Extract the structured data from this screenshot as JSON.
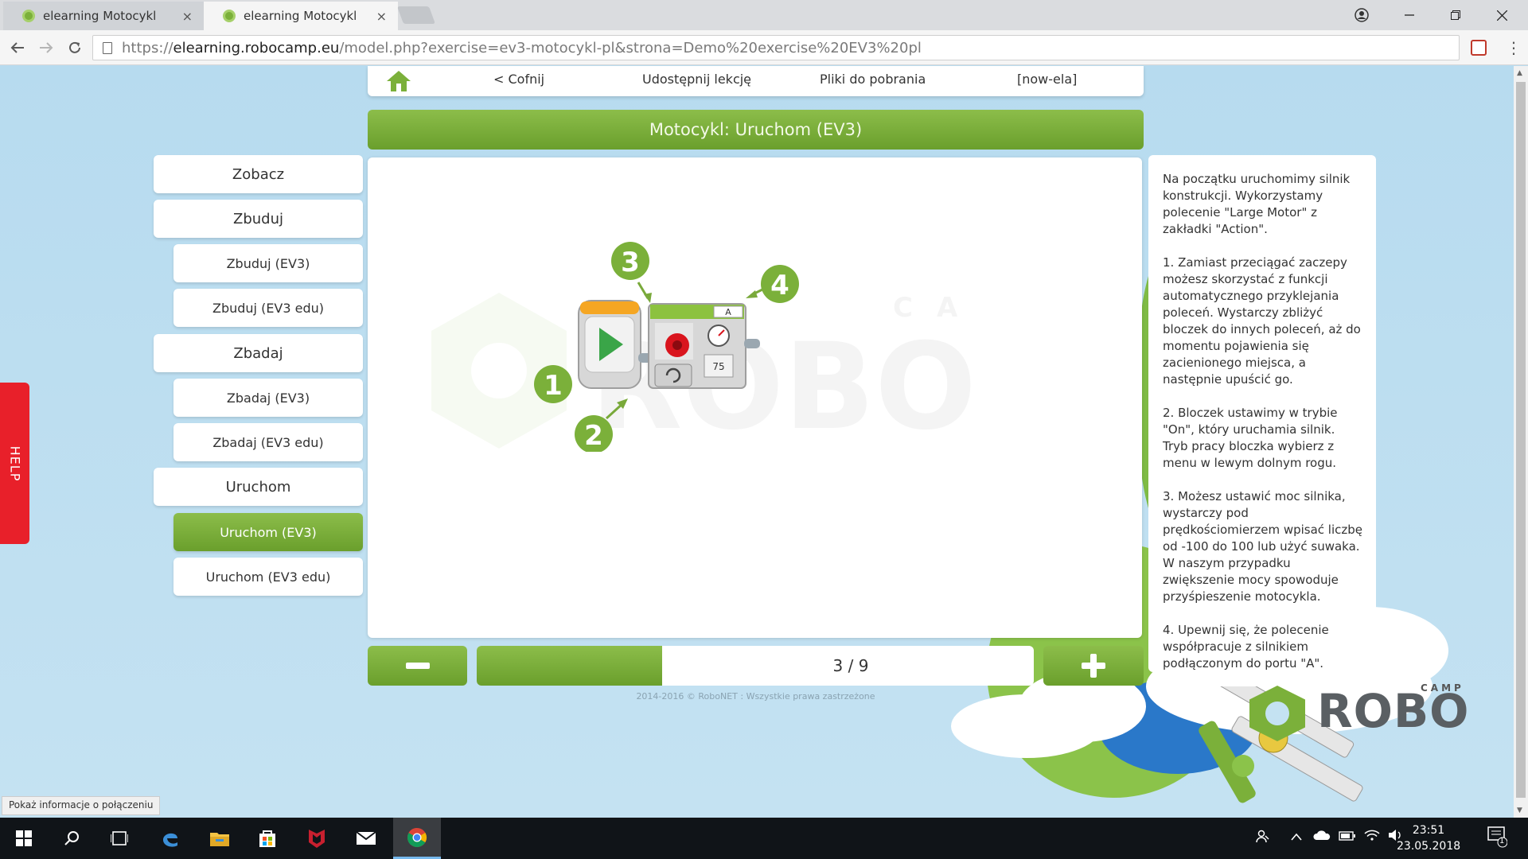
{
  "browser": {
    "tabs": [
      {
        "title": "elearning Motocykl",
        "close": "×"
      },
      {
        "title": "elearning Motocykl",
        "close": "×"
      }
    ],
    "url": {
      "scheme": "https://",
      "host": "elearning.robocamp.eu",
      "path": "/model.php?exercise=ev3-motocykl-pl&strona=Demo%20exercise%20EV3%20pl"
    },
    "status_bubble": "Pokaż informacje o połączeniu"
  },
  "topnav": {
    "back": "< Cofnij",
    "share": "Udostępnij lekcję",
    "downloads": "Pliki do pobrania",
    "user": "[now-ela]"
  },
  "title": "Motocykl: Uruchom (EV3)",
  "menu": [
    {
      "label": "Zobacz",
      "level": 1,
      "active": false
    },
    {
      "label": "Zbuduj",
      "level": 1,
      "active": false
    },
    {
      "label": "Zbuduj (EV3)",
      "level": 2,
      "active": false
    },
    {
      "label": "Zbuduj (EV3 edu)",
      "level": 2,
      "active": false
    },
    {
      "label": "Zbadaj",
      "level": 1,
      "active": false
    },
    {
      "label": "Zbadaj (EV3)",
      "level": 2,
      "active": false
    },
    {
      "label": "Zbadaj (EV3 edu)",
      "level": 2,
      "active": false
    },
    {
      "label": "Uruchom",
      "level": 1,
      "active": false
    },
    {
      "label": "Uruchom (EV3)",
      "level": 2,
      "active": true
    },
    {
      "label": "Uruchom (EV3 edu)",
      "level": 2,
      "active": false
    }
  ],
  "help_label": "HELP",
  "diagram": {
    "markers": [
      "1",
      "2",
      "3",
      "4"
    ],
    "port_label": "A",
    "power_value": "75",
    "watermark_small": "CAMP",
    "watermark_big": "ROBO"
  },
  "instructions": [
    "Na początku uruchomimy silnik konstrukcji. Wykorzystamy polecenie \"Large Motor\" z zakładki \"Action\".",
    "1. Zamiast przeciągać zaczepy możesz skorzystać z funkcji automatycznego przyklejania poleceń. Wystarczy zbliżyć bloczek do innych poleceń, aż do momentu pojawienia się zacienionego miejsca, a następnie upuścić go.",
    "2. Bloczek ustawimy w trybie \"On\", który uruchamia silnik. Tryb pracy bloczka wybierz z menu w lewym dolnym rogu.",
    "3. Możesz ustawić moc silnika, wystarczy pod prędkościomierzem wpisać liczbę od -100 do 100 lub użyć suwaka. W naszym przypadku zwiększenie mocy spowoduje przyśpieszenie motocykla.",
    "4. Upewnij się, że polecenie współpracuje z silnikiem podłączonym do portu \"A\"."
  ],
  "pager": {
    "current": 3,
    "total": 9,
    "label": "3 / 9",
    "fraction": 0.333
  },
  "footer": "2014-2016 © RoboNET : Wszystkie prawa zastrzeżone",
  "logo": {
    "camp": "CAMP",
    "robo": "ROBO"
  },
  "taskbar": {
    "time": "23:51",
    "date": "23.05.2018",
    "notifications": "1"
  },
  "colors": {
    "accent_green": "#7bb03a",
    "help_red": "#e8202a",
    "sky": "#b9dcef"
  },
  "icons": [
    "home-icon",
    "back-arrow-icon",
    "forward-arrow-icon",
    "reload-icon",
    "page-info-icon",
    "menu-dots-icon",
    "windows-start-icon",
    "search-icon",
    "task-view-icon",
    "edge-icon",
    "file-explorer-icon",
    "store-icon",
    "mcafee-icon",
    "mail-icon",
    "chrome-icon"
  ]
}
